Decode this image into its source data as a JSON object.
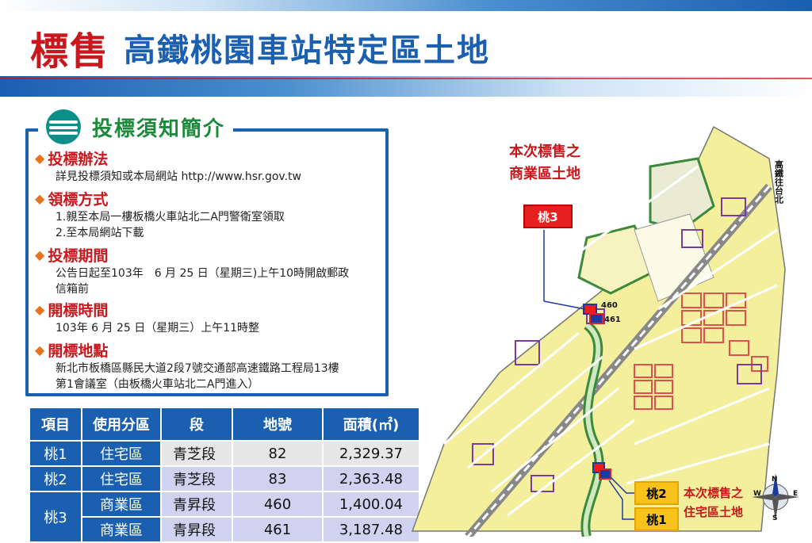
{
  "title": {
    "main": "標售",
    "sub": "高鐵桃園車站特定區土地"
  },
  "notice": {
    "heading": "投標須知簡介",
    "sections": [
      {
        "title": "投標辦法",
        "lines": [
          "詳見投標須知或本局網站 http://www.hsr.gov.tw"
        ]
      },
      {
        "title": "領標方式",
        "lines": [
          "1.親至本局一樓板橋火車站北二A門警衛室領取",
          "2.至本局網站下載"
        ]
      },
      {
        "title": "投標期間",
        "lines": [
          "公告日起至103年　6 月 25 日（星期三)上午10時開啟郵政",
          "信箱前"
        ]
      },
      {
        "title": "開標時間",
        "lines": [
          "103年 6 月 25 日（星期三）上午11時整"
        ]
      },
      {
        "title": "開標地點",
        "lines": [
          "新北市板橋區縣民大道2段7號交通部高速鐵路工程局13樓",
          "第1會議室（由板橋火車站北二A門進入）"
        ]
      }
    ]
  },
  "table": {
    "headers": [
      "項目",
      "使用分區",
      "段",
      "地號",
      "面積(㎡)"
    ],
    "rows": [
      {
        "item": "桃1",
        "zone": "住宅區",
        "section": "青芝段",
        "lot": "82",
        "area": "2,329.37"
      },
      {
        "item": "桃2",
        "zone": "住宅區",
        "section": "青芝段",
        "lot": "83",
        "area": "2,363.48"
      },
      {
        "item": "桃3",
        "zone": "商業區",
        "section": "青昇段",
        "lot": "460",
        "area": "1,400.04"
      },
      {
        "item": "",
        "zone": "商業區",
        "section": "青昇段",
        "lot": "461",
        "area": "3,187.48"
      }
    ]
  },
  "map": {
    "commercial_callout": [
      "本次標售之",
      "商業區土地"
    ],
    "tag3": "桃3",
    "tag2": "桃2",
    "tag1": "桃1",
    "residential_callout": [
      "本次標售之",
      "住宅區土地"
    ],
    "lot_460": "460",
    "lot_461": "461",
    "hsr_label": "高鐵往台北",
    "colors": {
      "residential": "#f3ef9c",
      "commercial": "#e05050",
      "green": "#3b8a3b",
      "road": "#ffffff"
    }
  }
}
